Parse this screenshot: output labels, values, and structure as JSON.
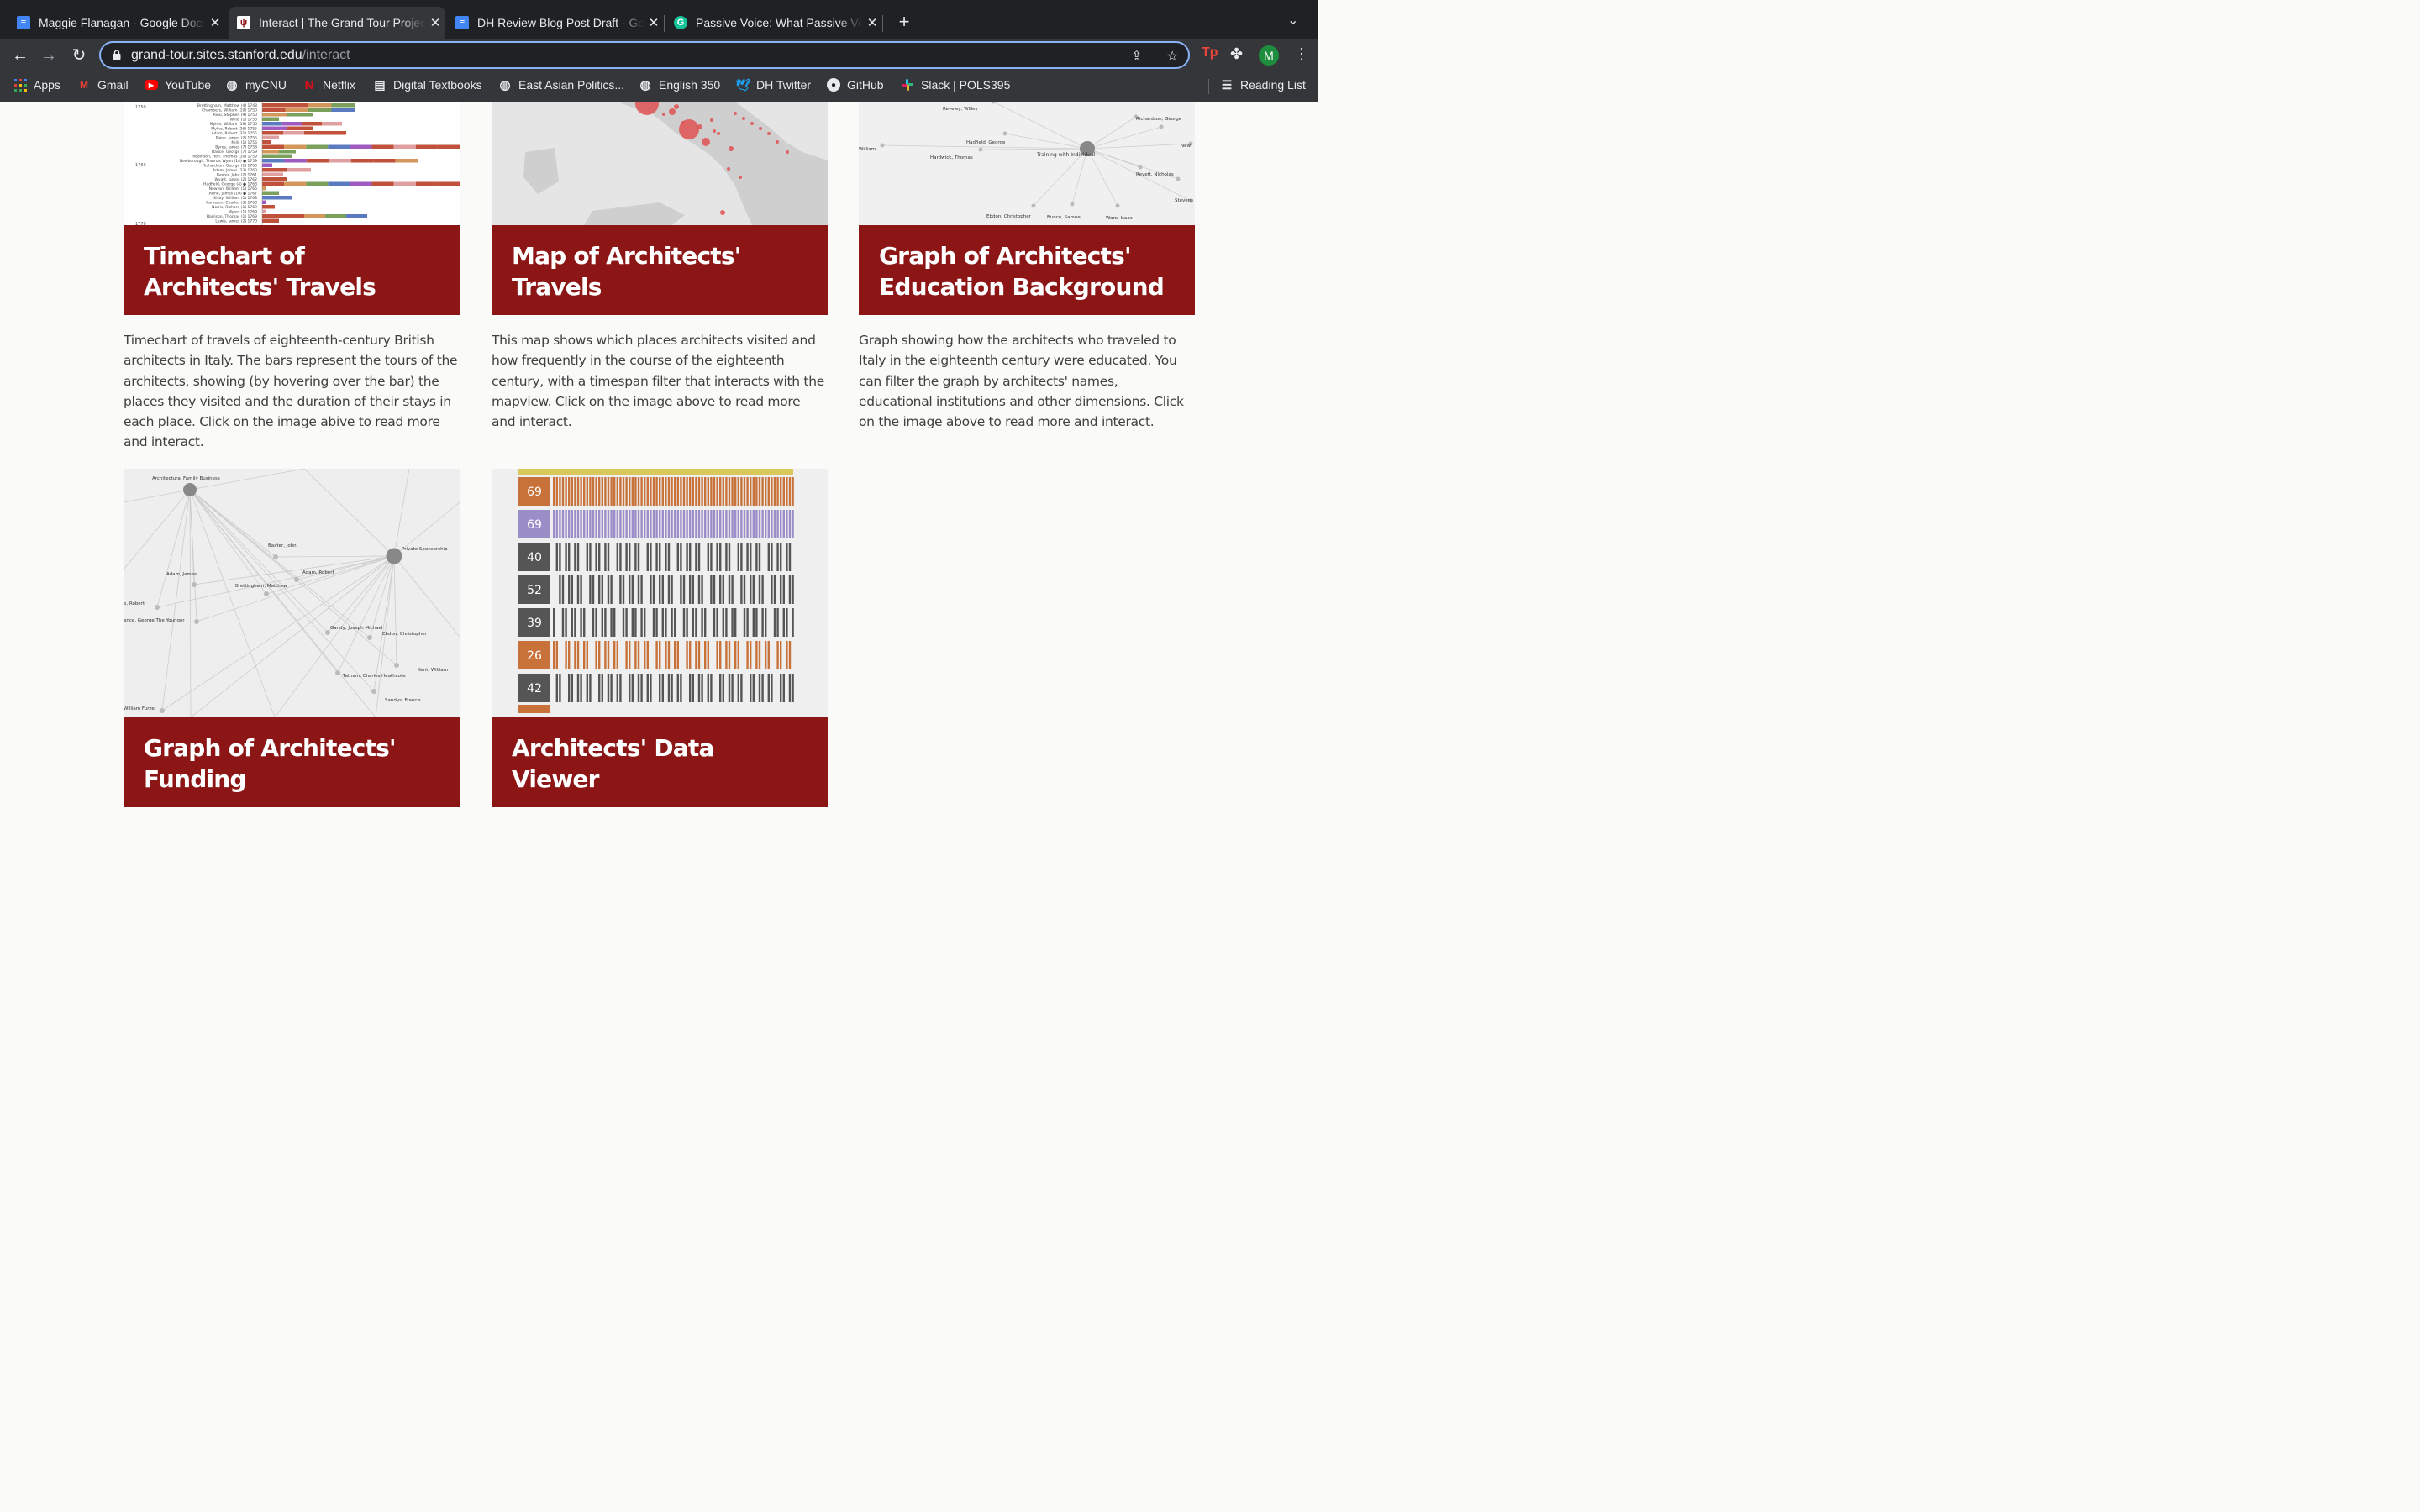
{
  "browser": {
    "tabs": [
      {
        "title": "Maggie Flanagan - Google Docs",
        "icon": "google-docs-icon",
        "active": false
      },
      {
        "title": "Interact | The Grand Tour Project",
        "icon": "stanford-tree-icon",
        "active": true
      },
      {
        "title": "DH Review Blog Post Draft - Google Docs",
        "icon": "google-docs-icon",
        "active": false
      },
      {
        "title": "Passive Voice: What Passive Voice Is",
        "icon": "grammarly-icon",
        "active": false
      }
    ],
    "url_host": "grand-tour.sites.stanford.edu",
    "url_path": "/interact",
    "profile_initial": "M",
    "bookmarks": [
      {
        "label": "Apps",
        "icon": "apps-grid-icon"
      },
      {
        "label": "Gmail",
        "icon": "gmail-icon"
      },
      {
        "label": "YouTube",
        "icon": "youtube-icon"
      },
      {
        "label": "myCNU",
        "icon": "globe-icon"
      },
      {
        "label": "Netflix",
        "icon": "netflix-icon"
      },
      {
        "label": "Digital Textbooks",
        "icon": "document-icon"
      },
      {
        "label": "East Asian Politics...",
        "icon": "globe-icon"
      },
      {
        "label": "English 350",
        "icon": "globe-icon"
      },
      {
        "label": "DH Twitter",
        "icon": "twitter-icon"
      },
      {
        "label": "GitHub",
        "icon": "github-icon"
      },
      {
        "label": "Slack | POLS395",
        "icon": "slack-icon"
      }
    ],
    "reading_list": "Reading List"
  },
  "cards": [
    {
      "title": "Timechart of Architects' Travels",
      "description": "Timechart of travels of eighteenth-century British architects in Italy. The bars represent the tours of the architects, showing (by hovering over the bar) the places they visited and the duration of their stays in each place. Click on the image abive to read more and interact."
    },
    {
      "title": "Map of Architects' Travels",
      "description": "This map shows which places architects visited and how frequently in the course of the eighteenth century, with a timespan filter that interacts with the mapview. Click on the image above to read more and interact."
    },
    {
      "title": "Graph of Architects' Education Background",
      "description": "Graph showing how the architects who traveled to Italy in the eighteenth century were educated. You can filter the graph by architects' names, educational institutions and other dimensions. Click on the image above to read more and interact."
    },
    {
      "title": "Graph of Architects' Funding",
      "description": ""
    },
    {
      "title": "Architects' Data Viewer",
      "description": ""
    }
  ],
  "thumbnails": {
    "timechart": {
      "year_labels": [
        "1750",
        "1760",
        "1770"
      ],
      "rows": [
        "Brettingham, Matthew (4) 1748",
        "Chambers, William (10) 1750",
        "Riou, Stephen (9) 1750",
        "Willis (1) 1755",
        "Mylne, William (19) 1755",
        "Mylne, Robert (26) 1755",
        "Adam, Robert (31) 1755",
        "Paine, James (2) 1755",
        "Mills (1) 1756",
        "Byres, James (7) 1758",
        "Dance, George (7) 1759",
        "Robinson, Hon. Thomas (10) 1759",
        "Newborough, Thomas Wynn (14) ● 1759",
        "Richardson, George (1) 1760",
        "Adam, James (23) 1760",
        "Baxter, John (2) 1761",
        "Wyatt, James (2) 1762",
        "Hadfield, George (4) ● 1763",
        "Newton, William (1) 1766",
        "Paine, James (10) ● 1767",
        "Kirby, William (1) 1768",
        "Cameron, Charles (3) 1768",
        "Norris, Richard (1) 1769",
        "Myres (1) 1769",
        "Harrison, Thomas (1) 1769",
        "Lewis, James (2) 1770"
      ]
    },
    "education_graph": {
      "hub_label": "Training with Individual",
      "labels": [
        "Reveley, Willey",
        "Richardson, George",
        "Hadfield, George",
        "William",
        "Hardwick, Thomas",
        "New",
        "Revett, Nicholas",
        "Stevens",
        "Ebdon, Christopher",
        "Bunce, Samuel",
        "Ware, Isaac"
      ]
    },
    "funding_graph": {
      "hubs": [
        "Architectural Family Business",
        "Private Sponsorship"
      ],
      "labels": [
        "Baxter, John",
        "Adam, James",
        "Adam, Robert",
        "Brettingham, Matthew",
        "e, Robert",
        "ance, George The Younger",
        "Gandy, Joseph Michael",
        "Ebdon, Christopher",
        "Kent, William",
        "Tatham, Charles Heathcote",
        "Sandys, Francis",
        "William Furze"
      ]
    },
    "data_viewer": {
      "rows": [
        {
          "count": "69",
          "color": "#c8723a"
        },
        {
          "count": "69",
          "color": "#9b8dc8"
        },
        {
          "count": "40",
          "color": "#555555"
        },
        {
          "count": "52",
          "color": "#555555"
        },
        {
          "count": "39",
          "color": "#555555"
        },
        {
          "count": "26",
          "color": "#c8723a"
        },
        {
          "count": "42",
          "color": "#555555"
        }
      ]
    }
  },
  "colors": {
    "banner": "#8c1515",
    "focus_ring": "#8ab4f8",
    "map_marker": "#e05252"
  }
}
